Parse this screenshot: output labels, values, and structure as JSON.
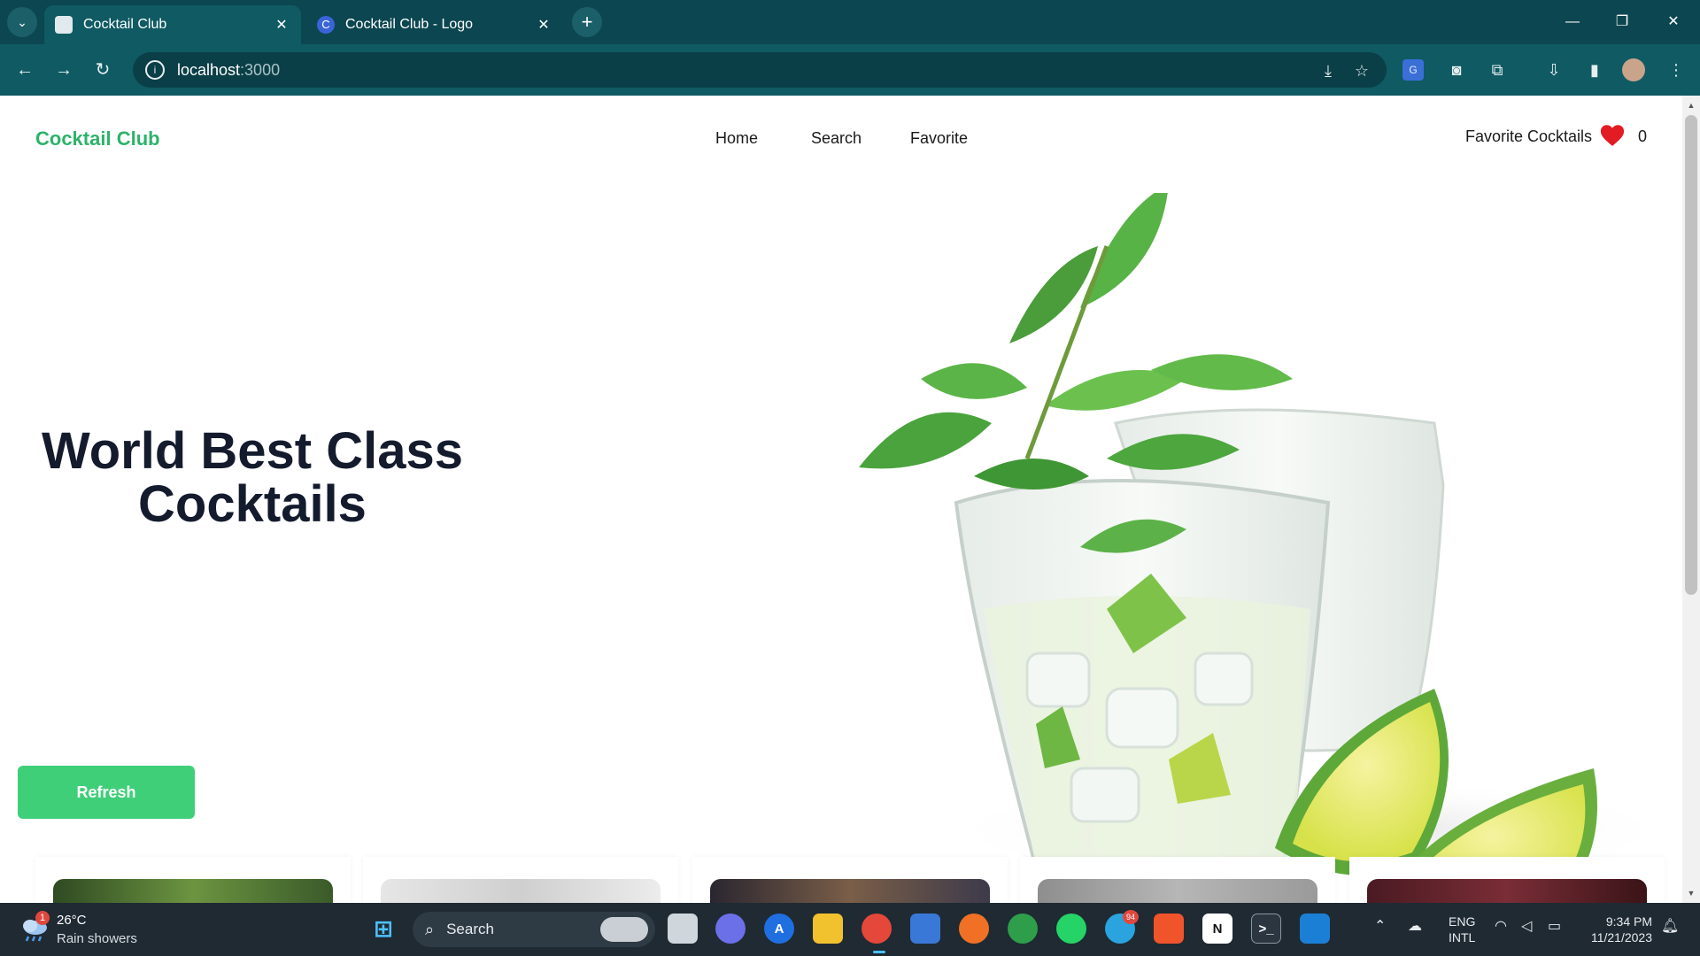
{
  "browser": {
    "tabs": [
      {
        "title": "Cocktail Club",
        "active": true
      },
      {
        "title": "Cocktail Club - Logo",
        "active": false
      }
    ],
    "url_host": "localhost",
    "url_port": ":3000"
  },
  "page": {
    "brand": "Cocktail Club",
    "nav": {
      "home": "Home",
      "search": "Search",
      "favorite": "Favorite"
    },
    "favorites": {
      "label": "Favorite Cocktails",
      "count": "0"
    },
    "hero": {
      "line1": "World Best Class",
      "line2": "Cocktails"
    },
    "refresh_label": "Refresh"
  },
  "taskbar": {
    "weather": {
      "temp": "26°C",
      "desc": "Rain showers",
      "badge": "1"
    },
    "search_label": "Search",
    "notification_badge": "94",
    "lang_line1": "ENG",
    "lang_line2": "INTL",
    "time": "9:34 PM",
    "date": "11/21/2023"
  },
  "colors": {
    "brand_green": "#2db36a",
    "button_green": "#3ecf78",
    "chrome_teal": "#0f5a63",
    "heart_red": "#e31b23"
  }
}
